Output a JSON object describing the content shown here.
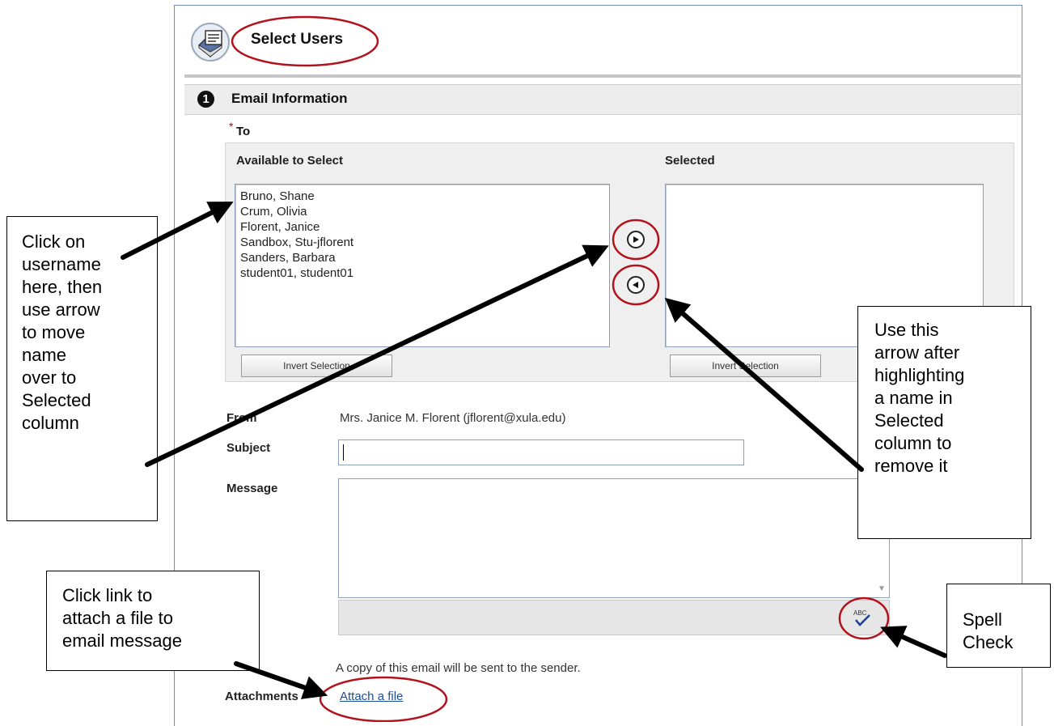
{
  "header": {
    "title": "Select Users",
    "icon": "email-envelope-icon"
  },
  "section": {
    "step": "1",
    "title": "Email Information"
  },
  "to": {
    "required_mark": "*",
    "label": "To",
    "available_label": "Available to Select",
    "selected_label": "Selected",
    "available_items": [
      "Bruno, Shane",
      "Crum, Olivia",
      "Florent, Janice",
      "Sandbox, Stu-jflorent",
      "Sanders, Barbara",
      "student01, student01"
    ],
    "selected_items": [],
    "invert_label": "Invert Selection"
  },
  "from": {
    "label": "From",
    "value": "Mrs. Janice M. Florent (jflorent@xula.edu)"
  },
  "subject": {
    "label": "Subject",
    "value": ""
  },
  "message": {
    "label": "Message",
    "value": "",
    "spellcheck_glyph": "ABC"
  },
  "copy_note": "A copy of this email will be sent to the sender.",
  "attachments": {
    "label": "Attachments",
    "link": "Attach a file"
  },
  "callouts": {
    "left": [
      "Click on",
      "username",
      "here, then",
      "use arrow",
      "to move",
      "name",
      "over to",
      "Selected",
      "column"
    ],
    "right": [
      "Use this",
      "arrow after",
      "highlighting",
      "a name in",
      "Selected",
      "column to",
      "remove it"
    ],
    "attach": [
      "Click link to",
      "attach a file to",
      "email message"
    ],
    "spell": [
      "Spell",
      "Check"
    ]
  },
  "colors": {
    "highlight_circle": "#b2121c",
    "link": "#1a4d9c",
    "frame": "#6f8fc4"
  }
}
